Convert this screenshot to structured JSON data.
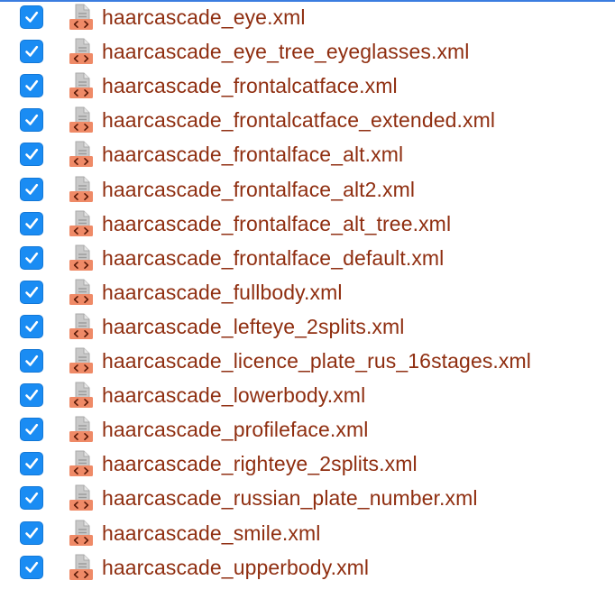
{
  "colors": {
    "checkbox": "#1a8cf3",
    "file_name_text": "#8f2e10",
    "xml_icon_badge": "#ef8a67",
    "document_icon": "#b9b9b9"
  },
  "checkbox_icon": "checkmark-icon",
  "file_icon": "xml-file-icon",
  "files": [
    {
      "name": "haarcascade_eye.xml",
      "checked": true
    },
    {
      "name": "haarcascade_eye_tree_eyeglasses.xml",
      "checked": true
    },
    {
      "name": "haarcascade_frontalcatface.xml",
      "checked": true
    },
    {
      "name": "haarcascade_frontalcatface_extended.xml",
      "checked": true
    },
    {
      "name": "haarcascade_frontalface_alt.xml",
      "checked": true
    },
    {
      "name": "haarcascade_frontalface_alt2.xml",
      "checked": true
    },
    {
      "name": "haarcascade_frontalface_alt_tree.xml",
      "checked": true
    },
    {
      "name": "haarcascade_frontalface_default.xml",
      "checked": true
    },
    {
      "name": "haarcascade_fullbody.xml",
      "checked": true
    },
    {
      "name": "haarcascade_lefteye_2splits.xml",
      "checked": true
    },
    {
      "name": "haarcascade_licence_plate_rus_16stages.xml",
      "checked": true
    },
    {
      "name": "haarcascade_lowerbody.xml",
      "checked": true
    },
    {
      "name": "haarcascade_profileface.xml",
      "checked": true
    },
    {
      "name": "haarcascade_righteye_2splits.xml",
      "checked": true
    },
    {
      "name": "haarcascade_russian_plate_number.xml",
      "checked": true
    },
    {
      "name": "haarcascade_smile.xml",
      "checked": true
    },
    {
      "name": "haarcascade_upperbody.xml",
      "checked": true
    }
  ]
}
